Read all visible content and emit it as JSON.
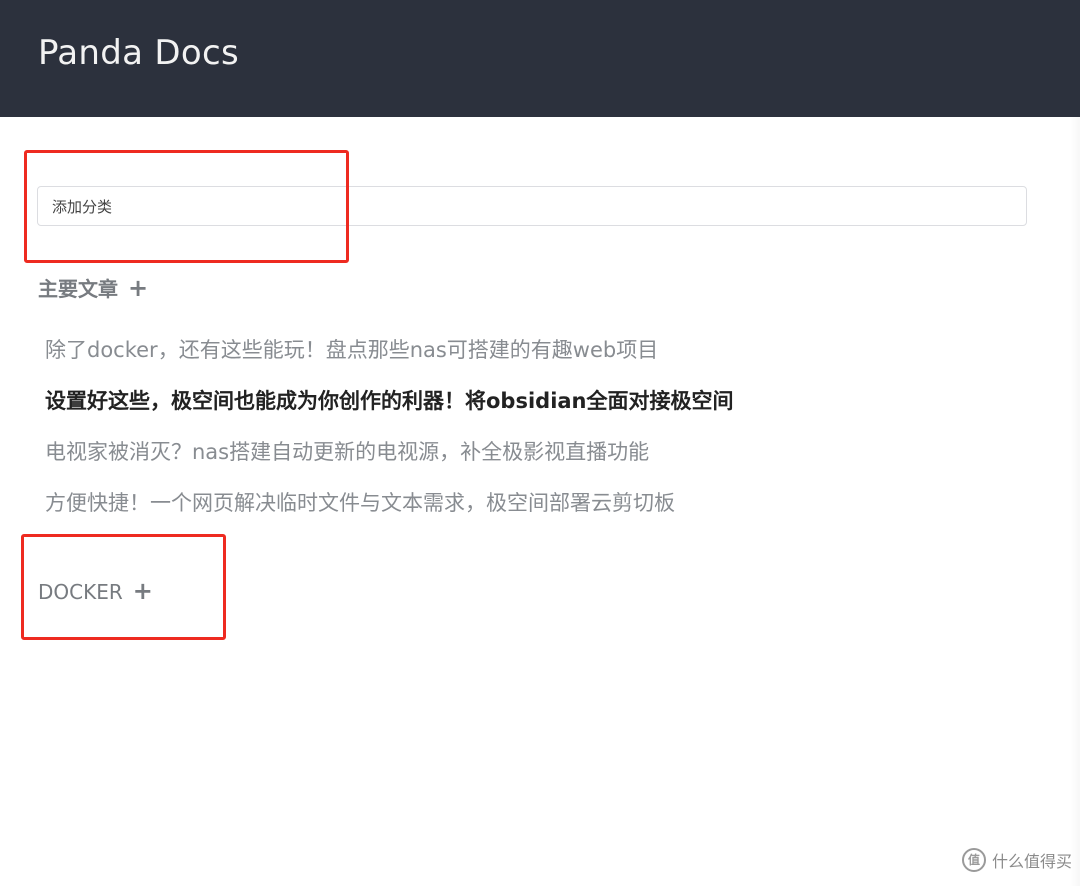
{
  "header": {
    "app_title": "Panda Docs",
    "background_color": "#2c313d"
  },
  "search": {
    "placeholder": "添加分类",
    "value": ""
  },
  "categories": [
    {
      "name": "主要文章",
      "add_icon": "plus-icon",
      "add_label": "+",
      "articles": [
        {
          "title": "除了docker，还有这些能玩！盘点那些nas可搭建的有趣web项目",
          "active": false
        },
        {
          "title": "设置好这些，极空间也能成为你创作的利器！将obsidian全面对接极空间",
          "active": true
        },
        {
          "title": "电视家被消灭？nas搭建自动更新的电视源，补全极影视直播功能",
          "active": false
        },
        {
          "title": "方便快捷！一个网页解决临时文件与文本需求，极空间部署云剪切板",
          "active": false
        }
      ]
    },
    {
      "name": "DOCKER",
      "add_icon": "plus-icon",
      "add_label": "+",
      "articles": []
    }
  ],
  "annotation": {
    "color": "#ee2a20"
  },
  "watermark": {
    "icon": "smzdm-logo",
    "logo_text": "值",
    "text": "什么值得买"
  }
}
